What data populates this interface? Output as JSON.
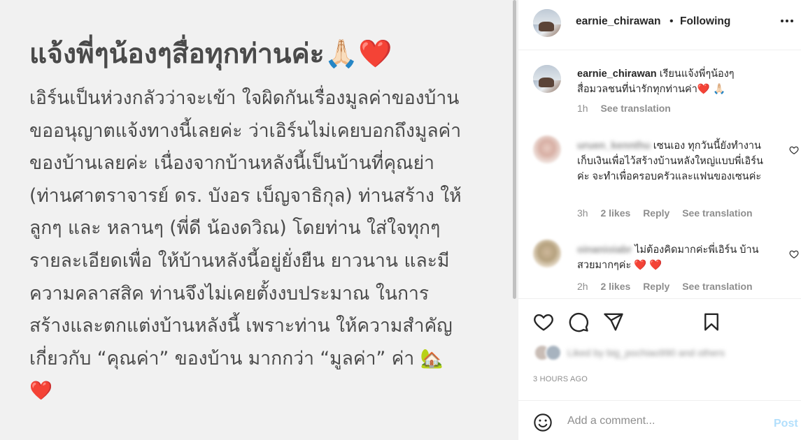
{
  "post": {
    "title": "แจ้งพี่ๆน้องๆสื่อทุกท่านค่ะ🙏🏻❤️",
    "lines": [
      "เอิร์นเป็นห่วงกลัวว่าจะเข้า ใจผิดกันเรื่องมูลค่าของบ้าน",
      "ขออนุญาตแจ้งทางนี้เลยค่ะ ว่าเอิร์นไม่เคยบอกถึงมูลค่า",
      "ของบ้านเลยค่ะ เนื่องจากบ้านหลังนี้เป็นบ้านที่คุณย่า",
      "(ท่านศาตราจารย์ ดร. บังอร เบ็ญจาธิกุล) ท่านสร้าง ให้",
      "ลูกๆ และ หลานๆ (พี่ดี น้องดวิณ) โดยท่าน ใส่ใจทุกๆ",
      "รายละเอียดเพื่อ ให้บ้านหลังนี้อยู่ยั่งยืน ยาวนาน และมี",
      "ความคลาสสิค ท่านจึงไม่เคยตั้งงบประมาณ ในการ",
      "สร้างและตกแต่งบ้านหลังนี้ เพราะท่าน ให้ความสำคัญ",
      "เกี่ยวกับ “คุณค่า” ของบ้าน มากกว่า “มูลค่า” ค่า 🏡",
      "❤️"
    ]
  },
  "header": {
    "username": "earnie_chirawan",
    "separator": "•",
    "follow_status": "Following",
    "more_icon": "more-horizontal-icon"
  },
  "comments": [
    {
      "username": "earnie_chirawan",
      "text": "เรียนแจ้งพี่ๆน้องๆ สื่อมวลชนที่น่ารักทุกท่านค่า❤️ 🙏🏻",
      "time": "1h",
      "see_translation": "See translation"
    },
    {
      "username": "uruen_kennthu",
      "text": "เซนเอง ทุกวันนี้ยังทำงานเก็บเงินเพื่อไว้สร้างบ้านหลังใหญ่แบบพี่เอิร์นค่ะ จะทำเพื่อครอบครัวและแฟนของเซนค่ะ",
      "time": "3h",
      "likes": "2 likes",
      "reply": "Reply",
      "see_translation": "See translation"
    },
    {
      "username": "oinanioiabr",
      "text": "ไม่ต้องคิดมากค่ะพี่เอิร์น บ้านสวยมากๆค่ะ ❤️ ❤️",
      "time": "2h",
      "likes": "2 likes",
      "reply": "Reply",
      "see_translation": "See translation"
    }
  ],
  "actions": {
    "icons": [
      "heart-icon",
      "comment-icon",
      "share-icon",
      "bookmark-icon"
    ]
  },
  "liked_by": "Liked by big_pochiao990 and others",
  "timestamp": "3 HOURS AGO",
  "add_comment": {
    "placeholder": "Add a comment...",
    "post_label": "Post"
  },
  "colors": {
    "text": "#262626",
    "secondary": "#8e8e8e",
    "border": "#efefef",
    "post_button": "#b2dffc",
    "heart_red": "#ed4956",
    "image_bg": "#f1f1f1"
  }
}
